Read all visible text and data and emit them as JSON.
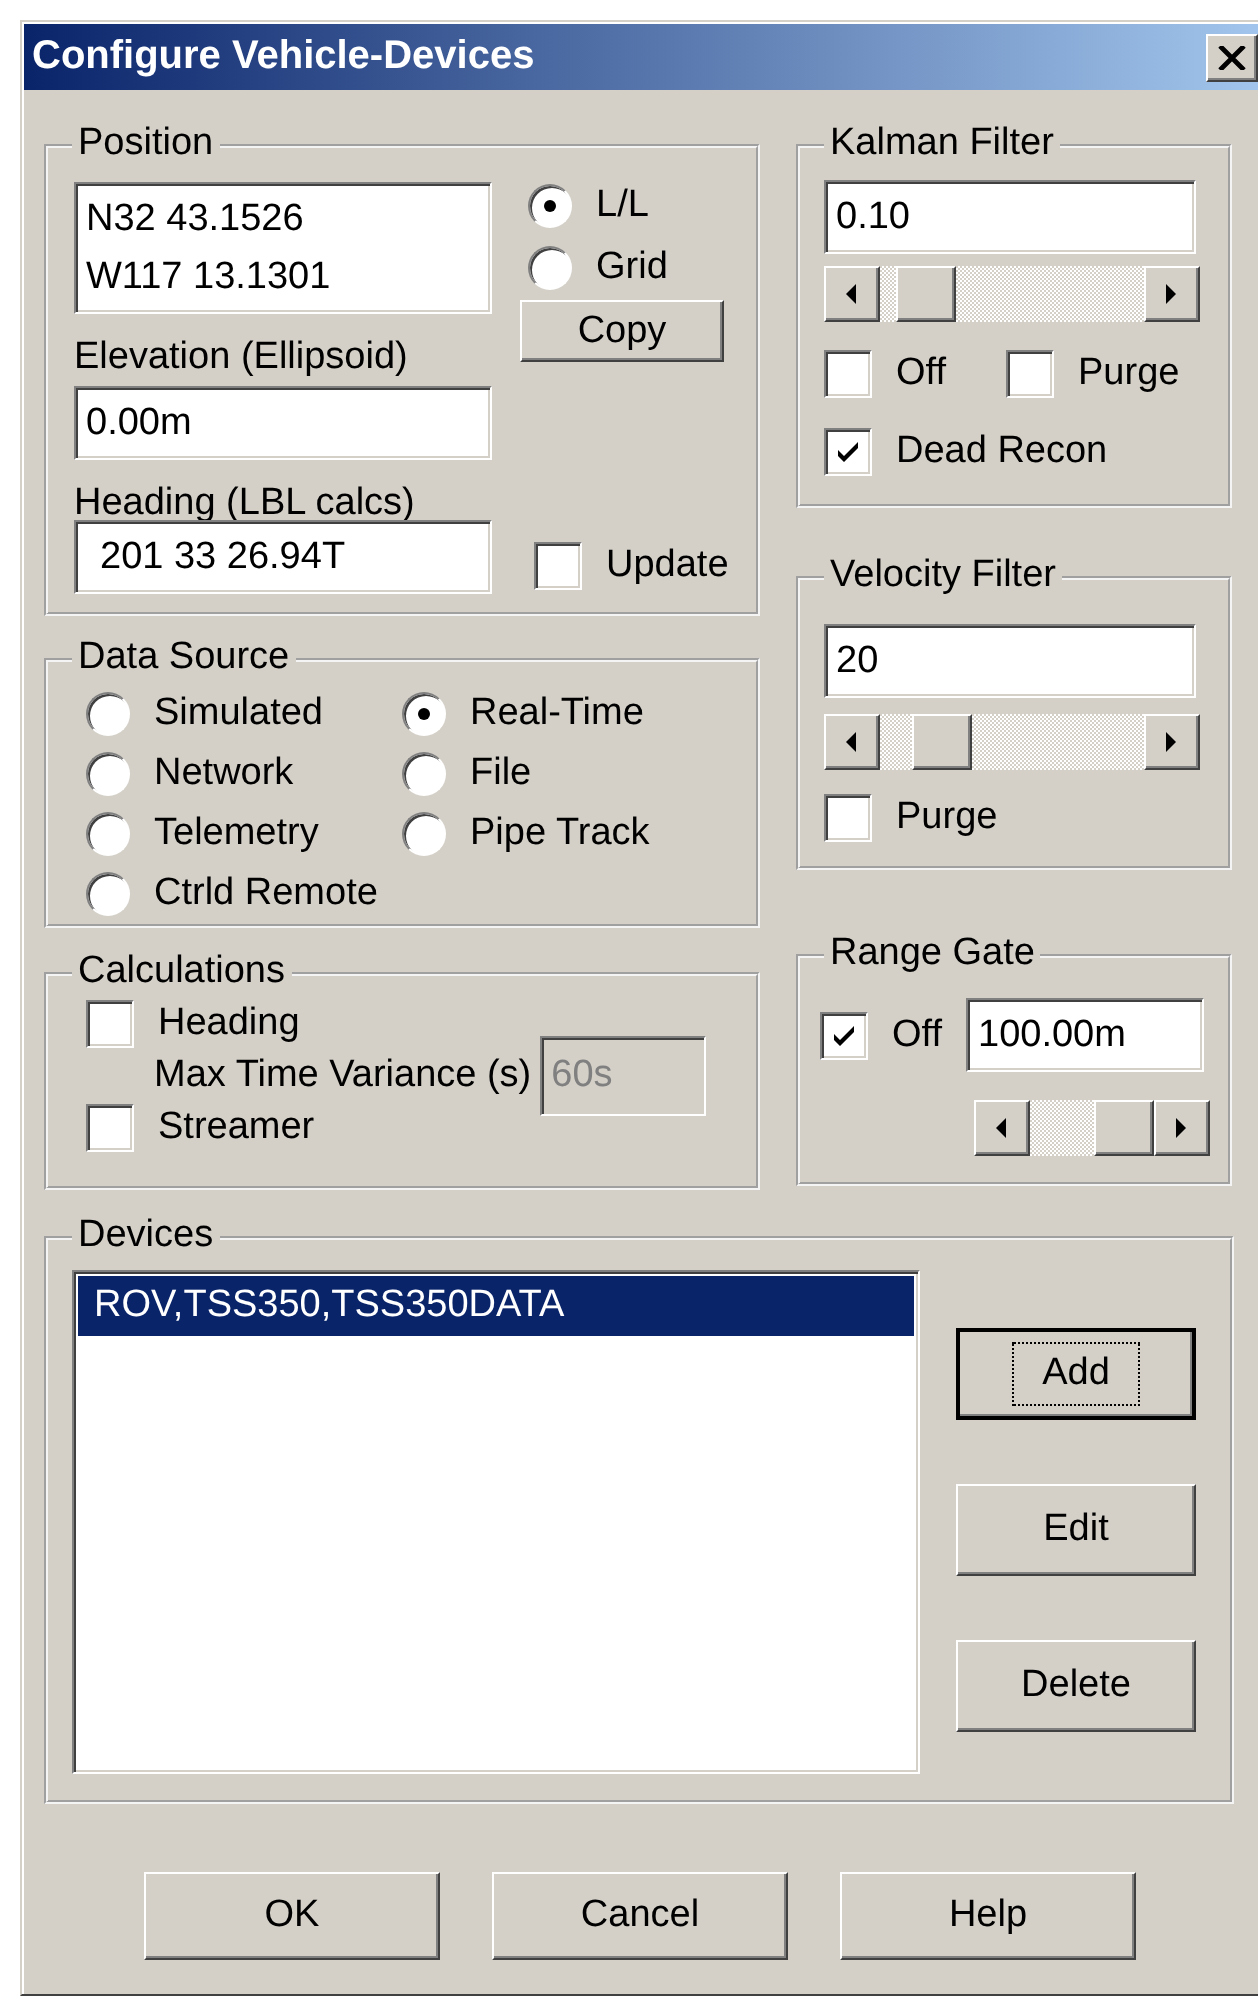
{
  "window": {
    "title": "Configure Vehicle-Devices"
  },
  "position": {
    "label": "Position",
    "coordinates": [
      "N32 43.1526",
      "W117 13.1301"
    ],
    "modes": [
      {
        "label": "L/L",
        "selected": true
      },
      {
        "label": "Grid",
        "selected": false
      }
    ],
    "copy_button": "Copy",
    "elevation_label": "Elevation (Ellipsoid)",
    "elevation": "0.00m",
    "heading_label": "Heading (LBL calcs)",
    "heading": "201 33 26.94T",
    "update": {
      "label": "Update",
      "checked": false
    }
  },
  "kalman_filter": {
    "label": "Kalman Filter",
    "value": "0.10",
    "level": 0.08,
    "options": [
      {
        "label": "Off",
        "checked": false
      },
      {
        "label": "Purge",
        "checked": false
      },
      {
        "label": "Dead Recon",
        "checked": true
      }
    ]
  },
  "data_source": {
    "label": "Data Source",
    "options": [
      {
        "label": "Simulated",
        "selected": false
      },
      {
        "label": "Real-Time",
        "selected": true
      },
      {
        "label": "Network",
        "selected": false
      },
      {
        "label": "File",
        "selected": false
      },
      {
        "label": "Telemetry",
        "selected": false
      },
      {
        "label": "Pipe Track",
        "selected": false
      },
      {
        "label": "Ctrld Remote",
        "selected": false
      }
    ]
  },
  "velocity_filter": {
    "label": "Velocity Filter",
    "value": "20",
    "level": 0.16,
    "purge": {
      "label": "Purge",
      "checked": false
    }
  },
  "calculations": {
    "label": "Calculations",
    "heading": {
      "label": "Heading",
      "checked": false
    },
    "variance_label": "Max Time Variance (s)",
    "variance": {
      "value": "60s",
      "disabled": true
    },
    "streamer": {
      "label": "Streamer",
      "checked": false
    }
  },
  "range_gate": {
    "label": "Range Gate",
    "off": {
      "label": "Off",
      "checked": true
    },
    "value": "100.00m",
    "level": 1
  },
  "devices": {
    "label": "Devices",
    "items": [
      {
        "label": "ROV,TSS350,TSS350DATA",
        "selected": true
      }
    ],
    "buttons": [
      {
        "label": "Add",
        "focused": true
      },
      {
        "label": "Edit",
        "focused": false
      },
      {
        "label": "Delete",
        "focused": false
      }
    ]
  },
  "buttons": [
    "OK",
    "Cancel",
    "Help"
  ]
}
